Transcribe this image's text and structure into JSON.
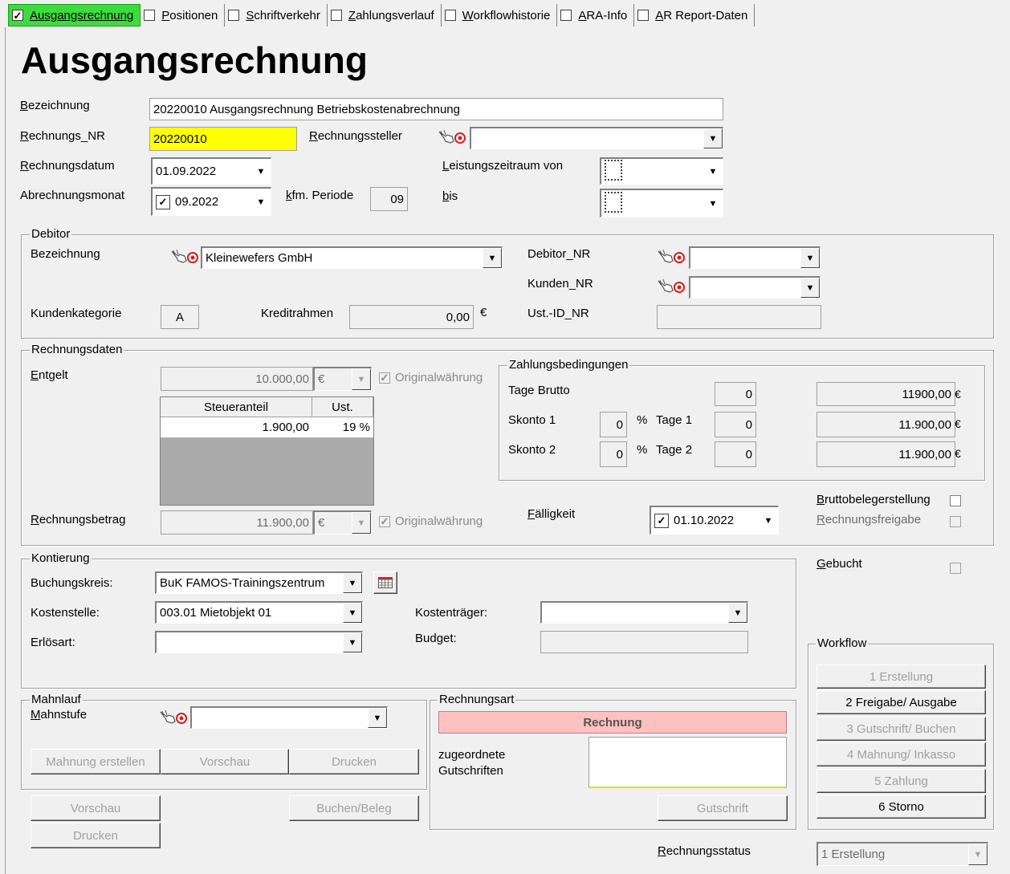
{
  "tabs": [
    {
      "label": "Ausgangsrechnung",
      "checked": true,
      "active": true
    },
    {
      "label": "Positionen",
      "checked": false,
      "active": false
    },
    {
      "label": "Schriftverkehr",
      "checked": false,
      "active": false
    },
    {
      "label": "Zahlungsverlauf",
      "checked": false,
      "active": false
    },
    {
      "label": "Workflowhistorie",
      "checked": false,
      "active": false
    },
    {
      "label": "ARA-Info",
      "checked": false,
      "active": false
    },
    {
      "label": "AR Report-Daten",
      "checked": false,
      "active": false
    }
  ],
  "page_title": "Ausgangsrechnung",
  "header": {
    "bezeichnung_label": "Bezeichnung",
    "bezeichnung_value": "20220010 Ausgangsrechnung Betriebskostenabrechnung",
    "rechnungs_nr_label": "Rechnungs_NR",
    "rechnungs_nr_value": "20220010",
    "rechnungssteller_label": "Rechnungssteller",
    "rechnungssteller_value": "",
    "rechnungsdatum_label": "Rechnungsdatum",
    "rechnungsdatum_value": "01.09.2022",
    "leistungszeitraum_von_label": "Leistungszeitraum von",
    "abrechnungsmonat_label": "Abrechnungsmonat",
    "abrechnungsmonat_value": "09.2022",
    "abrechnungsmonat_checked": true,
    "kfm_periode_label": "kfm. Periode",
    "kfm_periode_value": "09",
    "bis_label": "bis"
  },
  "debitor": {
    "group_title": "Debitor",
    "bezeichnung_label": "Bezeichnung",
    "bezeichnung_value": "Kleinewefers GmbH",
    "debitor_nr_label": "Debitor_NR",
    "kunden_nr_label": "Kunden_NR",
    "kundenkategorie_label": "Kundenkategorie",
    "kundenkategorie_value": "A",
    "kreditrahmen_label": "Kreditrahmen",
    "kreditrahmen_value": "0,00",
    "currency_symbol": "€",
    "ust_id_label": "Ust.-ID_NR"
  },
  "rechnungsdaten": {
    "group_title": "Rechnungsdaten",
    "entgelt_label": "Entgelt",
    "entgelt_value": "10.000,00",
    "currency": "€",
    "originalwaehrung_label": "Originalwährung",
    "tax_table": {
      "headers": [
        "Steueranteil",
        "Ust."
      ],
      "rows": [
        [
          "1.900,00",
          "19 %"
        ]
      ]
    },
    "rechnungsbetrag_label": "Rechnungsbetrag",
    "rechnungsbetrag_value": "11.900,00",
    "faelligkeit_label": "Fälligkeit",
    "faelligkeit_value": "01.10.2022",
    "bruttobelegerstellung_label": "Bruttobelegerstellung",
    "rechnungsfreigabe_label": "Rechnungsfreigabe"
  },
  "zahlungsbedingungen": {
    "group_title": "Zahlungsbedingungen",
    "tage_brutto_label": "Tage Brutto",
    "tage_brutto_value": "0",
    "tage_brutto_amount": "11900,00",
    "skonto1_label": "Skonto 1",
    "skonto1_value": "0",
    "percent_sign": "%",
    "tage1_label": "Tage 1",
    "tage1_value": "0",
    "skonto1_amount": "11.900,00",
    "skonto2_label": "Skonto 2",
    "skonto2_value": "0",
    "tage2_label": "Tage 2",
    "tage2_value": "0",
    "skonto2_amount": "11.900,00",
    "amount_suffix": "€"
  },
  "gebucht_label": "Gebucht",
  "kontierung": {
    "group_title": "Kontierung",
    "buchungskreis_label": "Buchungskreis:",
    "buchungskreis_value": "BuK FAMOS-Trainingszentrum",
    "kostenstelle_label": "Kostenstelle:",
    "kostenstelle_value": "003.01 Mietobjekt 01",
    "kostentraeger_label": "Kostenträger:",
    "erloesart_label": "Erlösart:",
    "budget_label": "Budget:"
  },
  "workflow": {
    "group_title": "Workflow",
    "steps": [
      {
        "label": "1 Erstellung",
        "enabled": false
      },
      {
        "label": "2 Freigabe/ Ausgabe",
        "enabled": true
      },
      {
        "label": "3 Gutschrift/ Buchen",
        "enabled": false
      },
      {
        "label": "4 Mahnung/ Inkasso",
        "enabled": false
      },
      {
        "label": "5 Zahlung",
        "enabled": false
      },
      {
        "label": "6 Storno",
        "enabled": true
      }
    ]
  },
  "mahnlauf": {
    "group_title": "Mahnlauf",
    "mahnstufe_label": "Mahnstufe",
    "mahnung_erstellen": "Mahnung erstellen",
    "vorschau": "Vorschau",
    "drucken": "Drucken"
  },
  "rechnungsart": {
    "group_title": "Rechnungsart",
    "value": "Rechnung",
    "zugeordnete_label_1": "zugeordnete",
    "zugeordnete_label_2": "Gutschriften",
    "gutschrift_button": "Gutschrift"
  },
  "bottom": {
    "vorschau": "Vorschau",
    "drucken": "Drucken",
    "buchen_beleg": "Buchen/Beleg",
    "rechnungsstatus_label": "Rechnungsstatus",
    "rechnungsstatus_value": "1 Erstellung"
  },
  "colors": {
    "active_tab": "#3cdc3c",
    "highlight_field": "#ffff00",
    "rechnungsart_bg": "#ffc0c0",
    "table_empty": "#ababab"
  },
  "icons": {
    "hand_target": "hand-pointer-target-icon",
    "calendar": "calendar-grid-icon"
  }
}
